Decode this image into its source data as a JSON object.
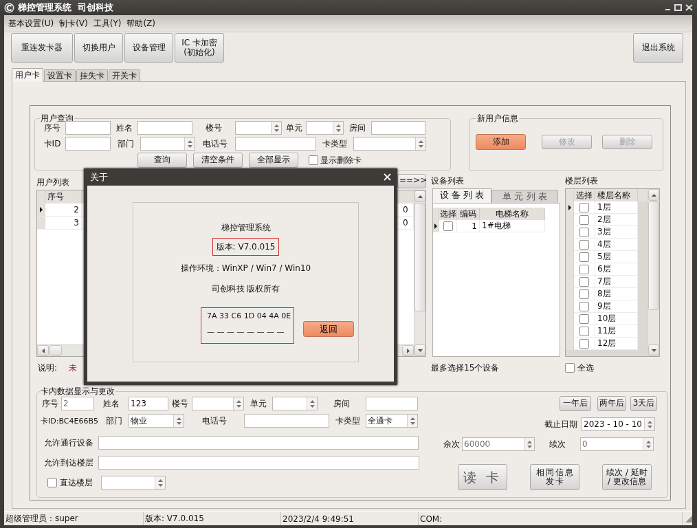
{
  "window": {
    "title": "梯控管理系统  司创科技"
  },
  "menu": [
    {
      "label": "基本设置(U)"
    },
    {
      "label": "制卡(V)"
    },
    {
      "label": "工具(Y)"
    },
    {
      "label": "帮助(Z)"
    }
  ],
  "toolbar": [
    {
      "label": "重连发卡器"
    },
    {
      "label": "切换用户"
    },
    {
      "label": "设备管理"
    },
    {
      "label": "IC 卡加密\n(初始化)"
    }
  ],
  "exit_button": {
    "label": "退出系统"
  },
  "tabs": [
    {
      "label": "用户卡",
      "selected": true
    },
    {
      "label": "设置卡",
      "selected": false
    },
    {
      "label": "挂失卡",
      "selected": false
    },
    {
      "label": "开关卡",
      "selected": false
    }
  ],
  "user_query": {
    "title": "用户查询",
    "first_line": [
      {
        "label": "序号",
        "kind": "text"
      },
      {
        "label": "姓名",
        "kind": "text"
      },
      {
        "label": "楼号",
        "kind": "spin"
      },
      {
        "label": "单元",
        "kind": "spin"
      },
      {
        "label": "房间",
        "kind": "text"
      }
    ],
    "second_line": [
      {
        "label": "卡ID",
        "kind": "text"
      },
      {
        "label": "部门",
        "kind": "spin"
      },
      {
        "label": "电话号",
        "kind": "text"
      },
      {
        "label": "卡类型",
        "kind": "spin"
      }
    ],
    "buttons": [
      {
        "label": "查询"
      },
      {
        "label": "清空条件"
      },
      {
        "label": "全部显示"
      }
    ],
    "show_deleted": {
      "label": "显示删除卡",
      "checked": false
    }
  },
  "new_user": {
    "title": "新用户信息",
    "buttons": [
      {
        "label": "添加",
        "kind": "primary",
        "disabled": false
      },
      {
        "label": "修改",
        "kind": "normal",
        "disabled": true
      },
      {
        "label": "删除",
        "kind": "normal",
        "disabled": true
      }
    ]
  },
  "user_list": {
    "title": "用户列表",
    "transfer_button": "==>>",
    "columns": [
      "序号"
    ],
    "rows": [
      {
        "number": "2",
        "last_column": "0",
        "current": true
      },
      {
        "number": "3",
        "last_column": "0",
        "current": false
      }
    ]
  },
  "note": {
    "label": "说明:",
    "text": "未"
  },
  "device_list": {
    "title": "设备列表",
    "tabs": [
      {
        "label": "设 备 列 表",
        "selected": true
      },
      {
        "label": "单 元 列 表",
        "selected": false
      }
    ],
    "columns": [
      "选择",
      "编码",
      "电梯名称"
    ],
    "rows": [
      {
        "checked": false,
        "code": "1",
        "name": "1#电梯",
        "current": true
      }
    ],
    "hint": "最多选择15个设备"
  },
  "floor_list": {
    "title": "楼层列表",
    "columns": [
      "选择",
      "楼层名称"
    ],
    "rows": [
      {
        "name": "1层",
        "checked": false,
        "current": true
      },
      {
        "name": "2层",
        "checked": false,
        "current": false
      },
      {
        "name": "3层",
        "checked": false,
        "current": false
      },
      {
        "name": "4层",
        "checked": false,
        "current": false
      },
      {
        "name": "5层",
        "checked": false,
        "current": false
      },
      {
        "name": "6层",
        "checked": false,
        "current": false
      },
      {
        "name": "7层",
        "checked": false,
        "current": false
      },
      {
        "name": "8层",
        "checked": false,
        "current": false
      },
      {
        "name": "9层",
        "checked": false,
        "current": false
      },
      {
        "name": "10层",
        "checked": false,
        "current": false
      },
      {
        "name": "11层",
        "checked": false,
        "current": false
      },
      {
        "name": "12层",
        "checked": false,
        "current": false
      }
    ],
    "select_all": {
      "label": "全选",
      "checked": false
    }
  },
  "card_data": {
    "title": "卡内数据显示与更改",
    "first_line": [
      {
        "label": "序号",
        "kind": "text",
        "value": "2",
        "disabled": true
      },
      {
        "label": "姓名",
        "kind": "text",
        "value": "123",
        "disabled": false
      },
      {
        "label": "楼号",
        "kind": "spin"
      },
      {
        "label": "单元",
        "kind": "spin"
      },
      {
        "label": "房间",
        "kind": "text"
      }
    ],
    "second_line": [
      {
        "label": "卡ID:BC4E66B5",
        "kind": "label"
      },
      {
        "label": "部门",
        "kind": "spin",
        "value": "物业",
        "disabled": false
      },
      {
        "label": "电话号",
        "kind": "text"
      },
      {
        "label": "卡类型",
        "kind": "spin",
        "value": "全通卡",
        "disabled": false
      }
    ],
    "allowed_devices": {
      "label": "允许通行设备"
    },
    "allowed_floors": {
      "label": "允许到达楼层"
    },
    "direct_floor": {
      "label": "直达楼层",
      "checked": false
    },
    "quick_dates": [
      {
        "label": "一年后"
      },
      {
        "label": "两年后"
      },
      {
        "label": "3天后"
      }
    ],
    "end_date": {
      "label": "截止日期",
      "value": "2023 - 10 - 10"
    },
    "remaining": {
      "label": "余次",
      "value": "60000",
      "disabled": true
    },
    "renewal": {
      "label": "续次",
      "value": "0",
      "disabled": true
    },
    "actions": [
      {
        "label": "读 卡",
        "kind": "large"
      },
      {
        "label": "相同信息发卡",
        "kind": "normal"
      },
      {
        "label": "续次 / 延时\n/ 更改信息",
        "kind": "normal"
      }
    ]
  },
  "status_bar": [
    "超级管理员：super",
    "版本: V7.0.015",
    "2023/2/4 9:49:51",
    "COM:"
  ],
  "about": {
    "title": "关于",
    "lines": [
      {
        "text": "梯控管理系统",
        "boxed": false
      },
      {
        "text": "版本: V7.0.015",
        "boxed": true
      },
      {
        "text": "操作环境：WinXP / Win7 / Win10",
        "boxed": false
      },
      {
        "text": "司创科技 版权所有",
        "boxed": false
      }
    ],
    "code": "7A 33 C6 1D 04 4A 0E",
    "dashes": "— — — — — — — —",
    "button": {
      "label": "返回",
      "kind": "primary"
    }
  }
}
